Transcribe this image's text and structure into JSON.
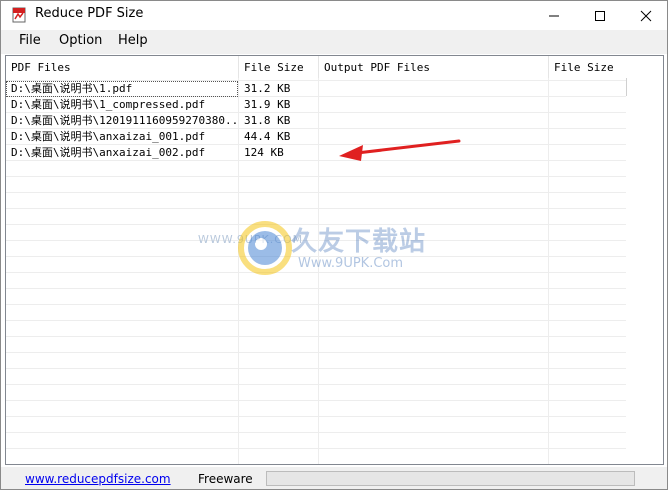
{
  "window": {
    "title": "Reduce PDF Size"
  },
  "menu": [
    "File",
    "Option",
    "Help"
  ],
  "columns": [
    "PDF Files",
    "File Size",
    "Output PDF Files",
    "File Size"
  ],
  "rows": [
    {
      "file": "D:\\桌面\\说明书\\1.pdf",
      "size": "31.2 KB",
      "output": "",
      "out_size": ""
    },
    {
      "file": "D:\\桌面\\说明书\\1_compressed.pdf",
      "size": "31.9 KB",
      "output": "",
      "out_size": ""
    },
    {
      "file": "D:\\桌面\\说明书\\1201911160959270380...",
      "size": "31.8 KB",
      "output": "",
      "out_size": ""
    },
    {
      "file": "D:\\桌面\\说明书\\anxaizai_001.pdf",
      "size": "44.4 KB",
      "output": "",
      "out_size": ""
    },
    {
      "file": "D:\\桌面\\说明书\\anxaizai_002.pdf",
      "size": "124 KB",
      "output": "",
      "out_size": ""
    }
  ],
  "watermark": {
    "www": "WWW.9UPK.COM",
    "brand": "久友下载站",
    "url": "Www.9UPK.Com"
  },
  "status": {
    "link": "www.reducepdfsize.com",
    "freeware": "Freeware",
    "progress": 0
  },
  "colors": {
    "arrow": "#e02020",
    "link": "#0000ee",
    "progress_fill": "#06b025"
  }
}
